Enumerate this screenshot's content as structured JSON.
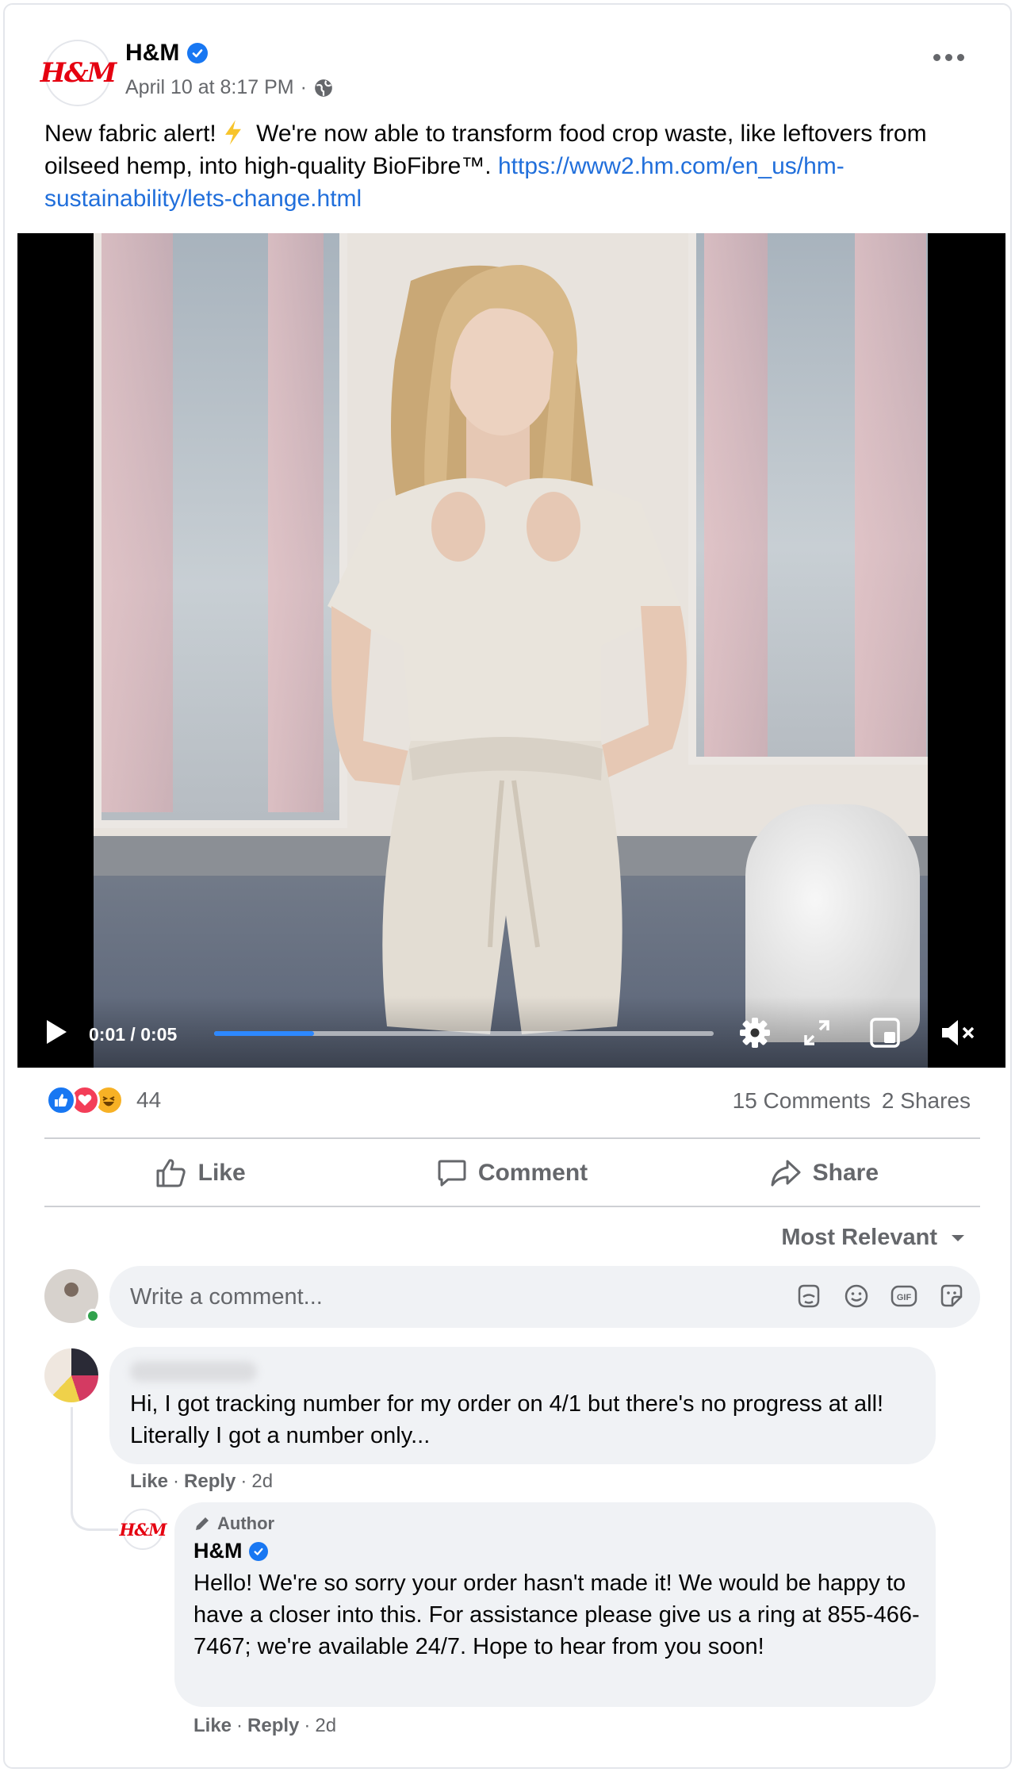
{
  "post": {
    "page_name": "H&M",
    "logo_text": "H&M",
    "timestamp": "April 10 at 8:17 PM",
    "separator": "·",
    "text_before_emoji": "New fabric alert!",
    "text_after_emoji": " We're now able to transform food crop waste, like leftovers from oilseed hemp, into high-quality BioFibre™. ",
    "link": "https://www2.hm.com/en_us/hm-sustainability/lets-change.html"
  },
  "video": {
    "current_time": "0:01",
    "duration": "0:05",
    "time_display": "0:01 / 0:05",
    "progress_fraction": 0.2
  },
  "stats": {
    "reaction_count": "44",
    "comments": "15 Comments",
    "shares": "2 Shares"
  },
  "actions": {
    "like": "Like",
    "comment": "Comment",
    "share": "Share"
  },
  "sort_label": "Most Relevant",
  "composer": {
    "placeholder": "Write a comment..."
  },
  "comments": [
    {
      "text": "Hi, I got tracking number for my order on 4/1 but there's no progress at all! Literally I got a number only...",
      "like": "Like",
      "reply": "Reply",
      "age": "2d"
    }
  ],
  "reply": {
    "author_tag": "Author",
    "name": "H&M",
    "logo_text": "H&M",
    "text": "Hello! We're so sorry your order hasn't made it! We would be happy to have a closer into this. For assistance please give us a ring at 855-466-7467; we're available 24/7. Hope to hear from you soon!",
    "like": "Like",
    "reply": "Reply",
    "age": "2d"
  },
  "colors": {
    "brand_red": "#e50010",
    "facebook_blue": "#1877f2",
    "link_blue": "#216fdb",
    "secondary_text": "#65676b"
  },
  "icons": [
    "globe-icon",
    "verified-badge-icon",
    "more-options-icon",
    "lightning-emoji",
    "play-icon",
    "settings-gear-icon",
    "fullscreen-icon",
    "miniplayer-icon",
    "muted-speaker-icon",
    "like-reaction-icon",
    "love-reaction-icon",
    "haha-reaction-icon",
    "thumbs-up-icon",
    "comment-bubble-icon",
    "share-arrow-icon",
    "caret-down-icon",
    "avatar-sticker-icon",
    "emoji-icon",
    "gif-icon",
    "sticker-icon",
    "pencil-icon"
  ]
}
